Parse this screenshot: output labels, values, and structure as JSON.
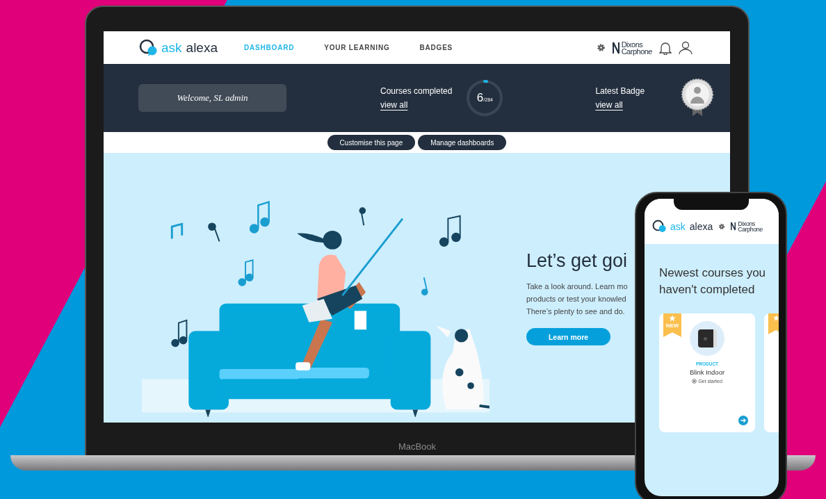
{
  "laptop": {
    "nav": {
      "logo": {
        "ask": "ask",
        "alexa": "alexa"
      },
      "tabs": [
        {
          "label": "DASHBOARD",
          "selected": true
        },
        {
          "label": "YOUR LEARNING",
          "selected": false
        },
        {
          "label": "BADGES",
          "selected": false
        }
      ],
      "brand": [
        "Dixons",
        "Carphone"
      ]
    },
    "banner": {
      "welcome": "Welcome, SL admin",
      "courses": {
        "label": "Courses completed",
        "link": "view all",
        "count": "6",
        "total": "/284",
        "level": 0.021
      },
      "badge": {
        "label": "Latest Badge",
        "link": "view all"
      }
    },
    "actions": [
      "Customise this page",
      "Manage dashboards"
    ],
    "hero": {
      "heading": "Let’s get goi",
      "lines": [
        "Take a look around. Learn mo",
        "products or test your knowled",
        "There’s plenty to see and do."
      ],
      "button": "Learn more"
    },
    "device_label": "MacBook"
  },
  "phone": {
    "logo": {
      "ask": "ask",
      "alexa": "alexa"
    },
    "brand": [
      "Dixons",
      "Carphone"
    ],
    "heading": "Newest courses you haven't completed",
    "cards": [
      {
        "kind": "full",
        "ribbon": "NEW",
        "category": "PRODUCT",
        "title": "Blink Indoor",
        "action": "Get started"
      },
      {
        "kind": "peek"
      }
    ]
  }
}
